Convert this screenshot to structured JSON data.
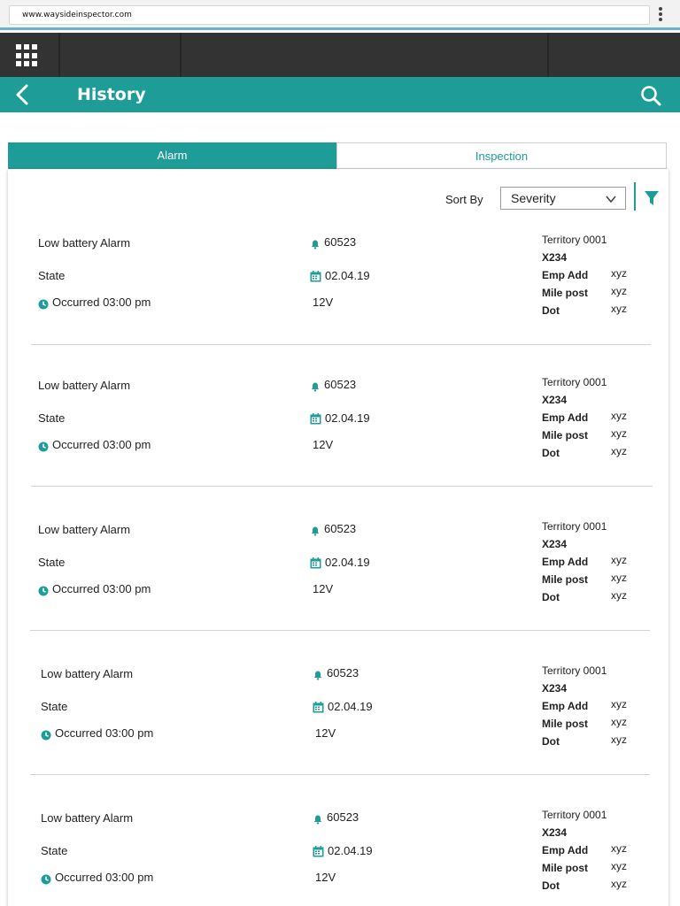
{
  "browser": {
    "url": "www.waysideinspector.com"
  },
  "header": {
    "title": "History"
  },
  "tabs": [
    {
      "label": "Alarm",
      "active": true
    },
    {
      "label": "Inspection",
      "active": false
    }
  ],
  "sort": {
    "label": "Sort By",
    "selected": "Severity"
  },
  "colors": {
    "accent": "#1e9d98",
    "toolbar": "#333333"
  },
  "alarms": [
    {
      "title": "Low battery Alarm",
      "id": "60523",
      "state_label": "State",
      "date": "02.04.19",
      "occurred": "Occurred 03:00 pm",
      "voltage": "12V",
      "territory": "Territory 0001",
      "code": "X234",
      "emp_add_label": "Emp Add",
      "emp_add": "xyz",
      "mile_post_label": "Mile post",
      "mile_post": "xyz",
      "dot_label": "Dot",
      "dot": "xyz"
    },
    {
      "title": "Low battery Alarm",
      "id": "60523",
      "state_label": "State",
      "date": "02.04.19",
      "occurred": "Occurred 03:00 pm",
      "voltage": "12V",
      "territory": "Territory 0001",
      "code": "X234",
      "emp_add_label": "Emp Add",
      "emp_add": "xyz",
      "mile_post_label": "Mile post",
      "mile_post": "xyz",
      "dot_label": "Dot",
      "dot": "xyz"
    },
    {
      "title": "Low battery Alarm",
      "id": "60523",
      "state_label": "State",
      "date": "02.04.19",
      "occurred": "Occurred 03:00 pm",
      "voltage": "12V",
      "territory": "Territory 0001",
      "code": "X234",
      "emp_add_label": "Emp Add",
      "emp_add": "xyz",
      "mile_post_label": "Mile post",
      "mile_post": "xyz",
      "dot_label": "Dot",
      "dot": "xyz"
    },
    {
      "title": "Low battery Alarm",
      "id": "60523",
      "state_label": "State",
      "date": "02.04.19",
      "occurred": "Occurred 03:00 pm",
      "voltage": "12V",
      "territory": "Territory 0001",
      "code": "X234",
      "emp_add_label": "Emp Add",
      "emp_add": "xyz",
      "mile_post_label": "Mile post",
      "mile_post": "xyz",
      "dot_label": "Dot",
      "dot": "xyz"
    },
    {
      "title": "Low battery Alarm",
      "id": "60523",
      "state_label": "State",
      "date": "02.04.19",
      "occurred": "Occurred 03:00 pm",
      "voltage": "12V",
      "territory": "Territory 0001",
      "code": "X234",
      "emp_add_label": "Emp Add",
      "emp_add": "xyz",
      "mile_post_label": "Mile post",
      "mile_post": "xyz",
      "dot_label": "Dot",
      "dot": "xyz"
    }
  ]
}
